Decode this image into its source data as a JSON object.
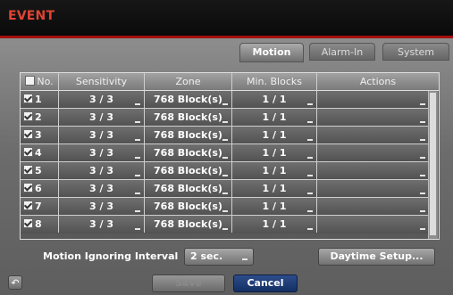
{
  "window": {
    "title": "EVENT"
  },
  "tabs": [
    {
      "label": "Motion",
      "active": true
    },
    {
      "label": "Alarm-In",
      "active": false
    },
    {
      "label": "System",
      "active": false
    }
  ],
  "table": {
    "columns": [
      "No.",
      "Sensitivity",
      "Zone",
      "Min. Blocks",
      "Actions"
    ],
    "rows": [
      {
        "no": "1",
        "sensitivity": "3 / 3",
        "zone": "768 Block(s)",
        "min_blocks": "1 / 1",
        "actions": ""
      },
      {
        "no": "2",
        "sensitivity": "3 / 3",
        "zone": "768 Block(s)",
        "min_blocks": "1 / 1",
        "actions": ""
      },
      {
        "no": "3",
        "sensitivity": "3 / 3",
        "zone": "768 Block(s)",
        "min_blocks": "1 / 1",
        "actions": ""
      },
      {
        "no": "4",
        "sensitivity": "3 / 3",
        "zone": "768 Block(s)",
        "min_blocks": "1 / 1",
        "actions": ""
      },
      {
        "no": "5",
        "sensitivity": "3 / 3",
        "zone": "768 Block(s)",
        "min_blocks": "1 / 1",
        "actions": ""
      },
      {
        "no": "6",
        "sensitivity": "3 / 3",
        "zone": "768 Block(s)",
        "min_blocks": "1 / 1",
        "actions": ""
      },
      {
        "no": "7",
        "sensitivity": "3 / 3",
        "zone": "768 Block(s)",
        "min_blocks": "1 / 1",
        "actions": ""
      },
      {
        "no": "8",
        "sensitivity": "3 / 3",
        "zone": "768 Block(s)",
        "min_blocks": "1 / 1",
        "actions": ""
      }
    ]
  },
  "motion_ignoring_interval": {
    "label": "Motion Ignoring Interval",
    "value": "2 sec."
  },
  "buttons": {
    "daytime_setup": "Daytime Setup...",
    "save": "Save",
    "cancel": "Cancel"
  },
  "icons": {
    "back": "back-arrow-icon"
  },
  "colors": {
    "title": "#e04433",
    "accent_line": "#a50f0f",
    "cancel_button": "#1f3b73"
  }
}
